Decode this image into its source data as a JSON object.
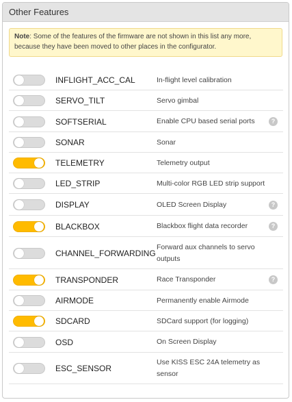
{
  "panel": {
    "title": "Other Features"
  },
  "note": {
    "label": "Note",
    "text": ": Some of the features of the firmware are not shown in this list any more, because they have been moved to other places in the configurator."
  },
  "colors": {
    "toggle_on": "#ffbb00",
    "toggle_off": "#dcdcdc",
    "note_bg": "#fff7cc"
  },
  "features": [
    {
      "name": "INFLIGHT_ACC_CAL",
      "description": "In-flight level calibration",
      "enabled": false,
      "help": false
    },
    {
      "name": "SERVO_TILT",
      "description": "Servo gimbal",
      "enabled": false,
      "help": false
    },
    {
      "name": "SOFTSERIAL",
      "description": "Enable CPU based serial ports",
      "enabled": false,
      "help": true,
      "help_icon": "?"
    },
    {
      "name": "SONAR",
      "description": "Sonar",
      "enabled": false,
      "help": false
    },
    {
      "name": "TELEMETRY",
      "description": "Telemetry output",
      "enabled": true,
      "help": false
    },
    {
      "name": "LED_STRIP",
      "description": "Multi-color RGB LED strip support",
      "enabled": false,
      "help": false
    },
    {
      "name": "DISPLAY",
      "description": "OLED Screen Display",
      "enabled": false,
      "help": true,
      "help_icon": "?"
    },
    {
      "name": "BLACKBOX",
      "description": "Blackbox flight data recorder",
      "enabled": true,
      "help": true,
      "help_icon": "?"
    },
    {
      "name": "CHANNEL_FORWARDING",
      "description": "Forward aux channels to servo outputs",
      "enabled": false,
      "help": false
    },
    {
      "name": "TRANSPONDER",
      "description": "Race Transponder",
      "enabled": true,
      "help": true,
      "help_icon": "?"
    },
    {
      "name": "AIRMODE",
      "description": "Permanently enable Airmode",
      "enabled": false,
      "help": false
    },
    {
      "name": "SDCARD",
      "description": "SDCard support (for logging)",
      "enabled": true,
      "help": false
    },
    {
      "name": "OSD",
      "description": "On Screen Display",
      "enabled": false,
      "help": false
    },
    {
      "name": "ESC_SENSOR",
      "description": "Use KISS ESC 24A telemetry as sensor",
      "enabled": false,
      "help": false
    }
  ]
}
